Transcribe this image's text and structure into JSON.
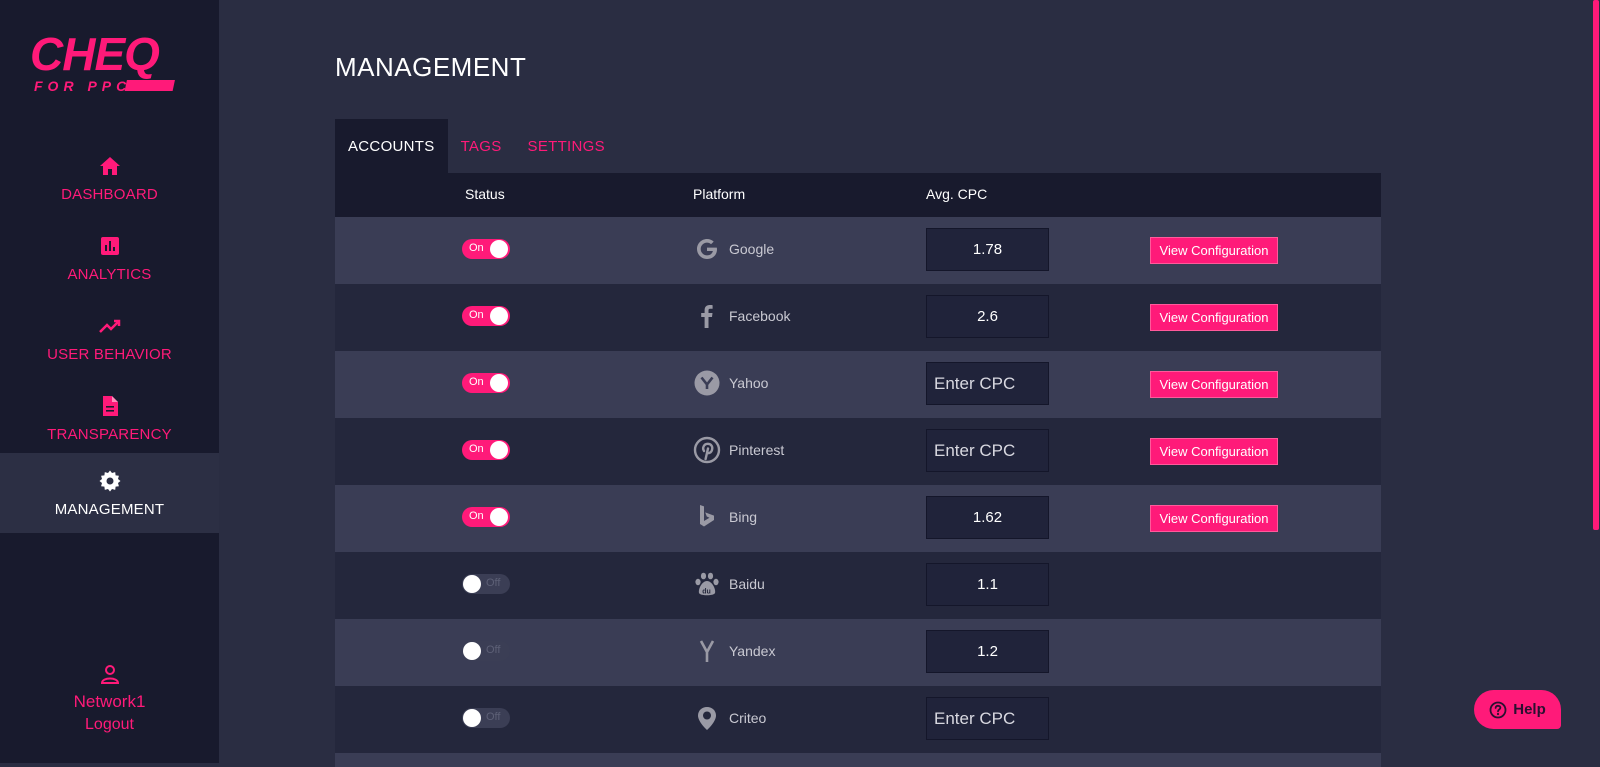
{
  "brand": {
    "name": "CHEQ",
    "tagline": "FOR PPC",
    "accent": "#ff1a79"
  },
  "sidebar": {
    "items": [
      {
        "label": "DASHBOARD",
        "icon": "home-icon"
      },
      {
        "label": "ANALYTICS",
        "icon": "bar-chart-icon"
      },
      {
        "label": "USER BEHAVIOR",
        "icon": "trend-line-icon"
      },
      {
        "label": "TRANSPARENCY",
        "icon": "document-icon"
      },
      {
        "label": "MANAGEMENT",
        "icon": "gear-icon",
        "active": true
      }
    ],
    "user": {
      "name": "Network1",
      "logout": "Logout",
      "icon": "user-icon"
    }
  },
  "page": {
    "title": "MANAGEMENT",
    "tabs": [
      {
        "label": "ACCOUNTS",
        "active": true
      },
      {
        "label": "TAGS"
      },
      {
        "label": "SETTINGS"
      }
    ]
  },
  "table": {
    "columns": {
      "status": "Status",
      "platform": "Platform",
      "cpc": "Avg. CPC"
    },
    "on_label": "On",
    "off_label": "Off",
    "cpc_placeholder": "Enter CPC",
    "view_button": "View Configuration",
    "rows": [
      {
        "platform": "Google",
        "icon": "google-icon",
        "status": "on",
        "cpc": "1.78"
      },
      {
        "platform": "Facebook",
        "icon": "facebook-icon",
        "status": "on",
        "cpc": "2.6"
      },
      {
        "platform": "Yahoo",
        "icon": "yahoo-icon",
        "status": "on",
        "cpc": ""
      },
      {
        "platform": "Pinterest",
        "icon": "pinterest-icon",
        "status": "on",
        "cpc": ""
      },
      {
        "platform": "Bing",
        "icon": "bing-icon",
        "status": "on",
        "cpc": "1.62"
      },
      {
        "platform": "Baidu",
        "icon": "baidu-icon",
        "status": "off",
        "cpc": "1.1"
      },
      {
        "platform": "Yandex",
        "icon": "yandex-icon",
        "status": "off",
        "cpc": "1.2"
      },
      {
        "platform": "Criteo",
        "icon": "criteo-icon",
        "status": "off",
        "cpc": ""
      }
    ]
  },
  "help": {
    "label": "Help",
    "icon": "question-circle-icon"
  }
}
